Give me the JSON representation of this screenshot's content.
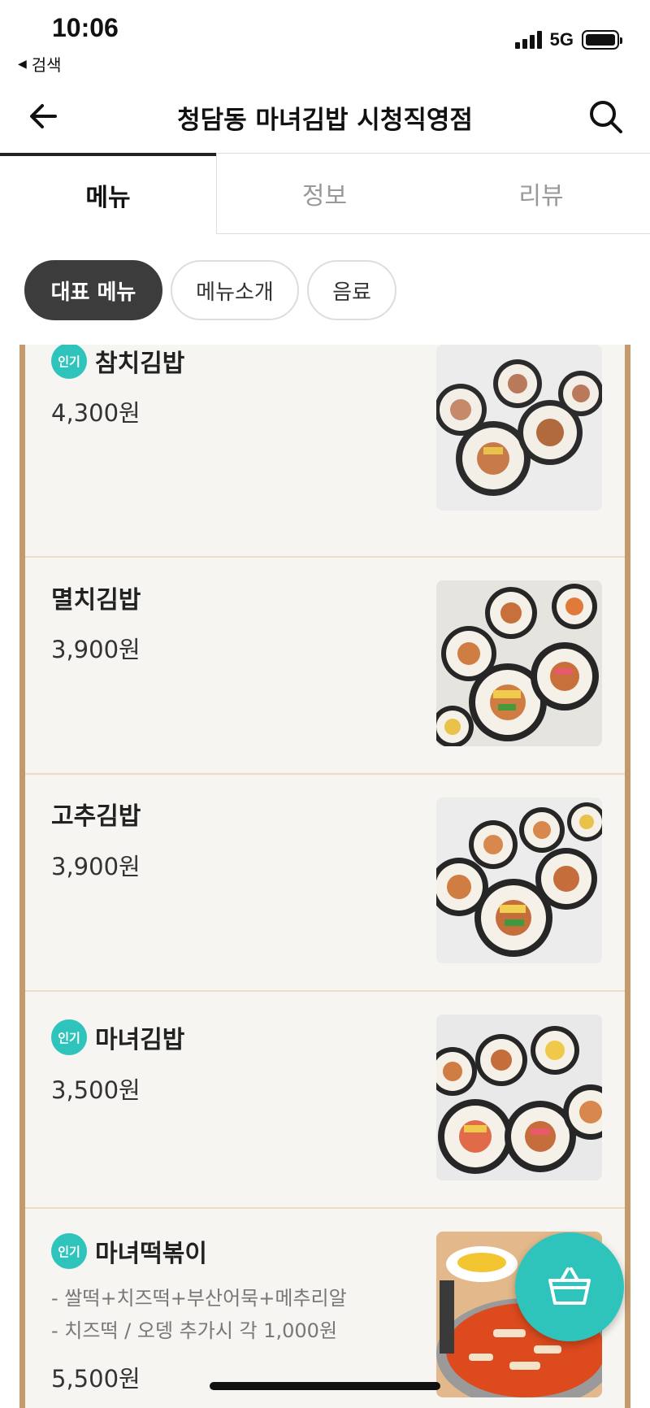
{
  "status_bar": {
    "time": "10:06",
    "back_app": "검색",
    "network": "5G"
  },
  "header": {
    "title": "청담동 마녀김밥 시청직영점"
  },
  "tabs": [
    {
      "label": "메뉴"
    },
    {
      "label": "정보"
    },
    {
      "label": "리뷰"
    }
  ],
  "chips": [
    {
      "label": "대표 메뉴"
    },
    {
      "label": "메뉴소개"
    },
    {
      "label": "음료"
    }
  ],
  "menu": [
    {
      "badge": "인기",
      "name": "참치김밥",
      "price": "4,300원"
    },
    {
      "name": "멸치김밥",
      "price": "3,900원"
    },
    {
      "name": "고추김밥",
      "price": "3,900원"
    },
    {
      "badge": "인기",
      "name": "마녀김밥",
      "price": "3,500원"
    },
    {
      "badge": "인기",
      "name": "마녀떡볶이",
      "desc": [
        "- 쌀떡+치즈떡+부산어묵+메추리알",
        "- 치즈떡 / 오뎅 추가시 각 1,000원"
      ],
      "price": "5,500원"
    }
  ],
  "colors": {
    "accent": "#2ec4bc",
    "frame": "#c49a6c",
    "chip_active": "#3c3c3c"
  }
}
